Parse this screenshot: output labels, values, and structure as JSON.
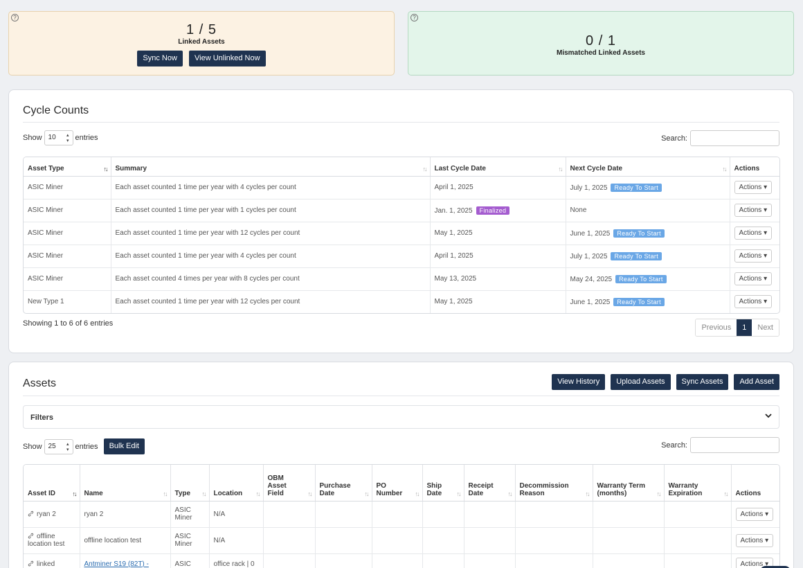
{
  "linked": {
    "count": "1 / 5",
    "label": "Linked Assets",
    "sync_label": "Sync Now",
    "view_label": "View Unlinked Now",
    "help": "?"
  },
  "mismatched": {
    "count": "0 / 1",
    "label": "Mismatched Linked Assets",
    "help": "?"
  },
  "cycle": {
    "title": "Cycle Counts",
    "show_label": "Show",
    "entries_label": "entries",
    "page_size": "10",
    "search_label": "Search:",
    "columns": [
      "Asset Type",
      "Summary",
      "Last Cycle Date",
      "Next Cycle Date",
      "Actions"
    ],
    "rows": [
      {
        "type": "ASIC Miner",
        "summary": "Each asset counted 1 time per year with 4 cycles per count",
        "last": "April 1, 2025",
        "last_badge": "",
        "next": "July 1, 2025",
        "next_badge": "Ready To Start",
        "action": "Actions ▾"
      },
      {
        "type": "ASIC Miner",
        "summary": "Each asset counted 1 time per year with 1 cycles per count",
        "last": "Jan. 1, 2025",
        "last_badge": "Finalized",
        "next": "None",
        "next_badge": "",
        "action": "Actions ▾"
      },
      {
        "type": "ASIC Miner",
        "summary": "Each asset counted 1 time per year with 12 cycles per count",
        "last": "May 1, 2025",
        "last_badge": "",
        "next": "June 1, 2025",
        "next_badge": "Ready To Start",
        "action": "Actions ▾"
      },
      {
        "type": "ASIC Miner",
        "summary": "Each asset counted 1 time per year with 4 cycles per count",
        "last": "April 1, 2025",
        "last_badge": "",
        "next": "July 1, 2025",
        "next_badge": "Ready To Start",
        "action": "Actions ▾"
      },
      {
        "type": "ASIC Miner",
        "summary": "Each asset counted 4 times per year with 8 cycles per count",
        "last": "May 13, 2025",
        "last_badge": "",
        "next": "May 24, 2025",
        "next_badge": "Ready To Start",
        "action": "Actions ▾"
      },
      {
        "type": "New Type 1",
        "summary": "Each asset counted 1 time per year with 12 cycles per count",
        "last": "May 1, 2025",
        "last_badge": "",
        "next": "June 1, 2025",
        "next_badge": "Ready To Start",
        "action": "Actions ▾"
      }
    ],
    "showing_text": "Showing 1 to 6 of 6 entries",
    "pager": {
      "prev": "Previous",
      "page": "1",
      "next": "Next"
    }
  },
  "assets": {
    "title": "Assets",
    "buttons": {
      "history": "View History",
      "upload": "Upload Assets",
      "sync": "Sync Assets",
      "add": "Add Asset"
    },
    "filters_label": "Filters",
    "show_label": "Show",
    "entries_label": "entries",
    "page_size": "25",
    "bulk_edit": "Bulk Edit",
    "search_label": "Search:",
    "columns": [
      "Asset ID",
      "Name",
      "Type",
      "Location",
      "OBM Asset Field",
      "Purchase Date",
      "PO Number",
      "Ship Date",
      "Receipt Date",
      "Decommission Reason",
      "Warranty Term (months)",
      "Warranty Expiration",
      "Actions"
    ],
    "rows": [
      {
        "id": "ryan 2",
        "name": "ryan 2",
        "type": "ASIC Miner",
        "location": "N/A",
        "action": "Actions ▾"
      },
      {
        "id": "offline location test",
        "name": "offline location test",
        "type": "ASIC Miner",
        "location": "N/A",
        "action": "Actions ▾"
      },
      {
        "id": "linked",
        "name": "Antminer S19 (82T) -",
        "type": "ASIC",
        "location": "office rack | 0",
        "action": "Actions ▾"
      }
    ]
  }
}
